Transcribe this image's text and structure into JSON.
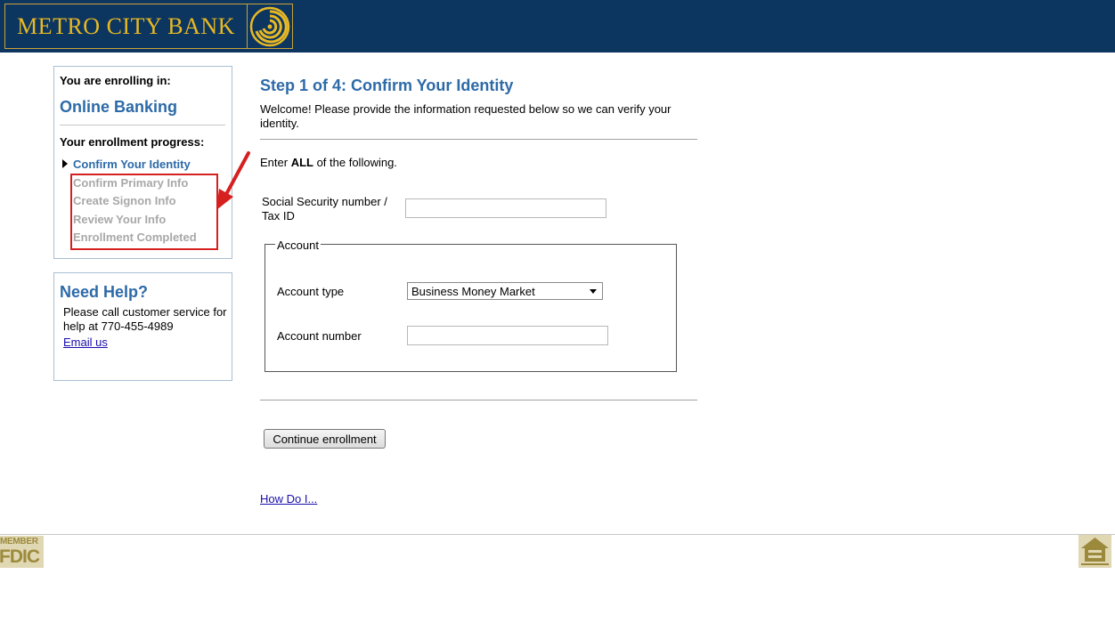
{
  "header": {
    "bank_name": "METRO CITY BANK",
    "logo_icon": "gold-swirl-emblem-icon",
    "colors": {
      "header_bg": "#0c3560",
      "logo_gold": "#e8b923"
    }
  },
  "sidebar": {
    "enroll_label": "You are enrolling in:",
    "product_name": "Online Banking",
    "progress_label": "Your enrollment progress:",
    "steps": [
      {
        "label": "Confirm Your Identity",
        "state": "current"
      },
      {
        "label": "Confirm Primary Info",
        "state": "pending"
      },
      {
        "label": "Create Signon Info",
        "state": "pending"
      },
      {
        "label": "Review Your Info",
        "state": "pending"
      },
      {
        "label": "Enrollment Completed",
        "state": "pending"
      }
    ],
    "help": {
      "title": "Need Help?",
      "text": "Please call customer service for help at  770-455-4989",
      "email_link": "Email us"
    }
  },
  "main": {
    "step_title": "Step 1 of 4: Confirm Your Identity",
    "description": "Welcome! Please provide the information requested below so we can verify your identity.",
    "enter_all": {
      "prefix": "Enter ",
      "bold": "ALL",
      "suffix": " of the following."
    },
    "ssn": {
      "label": "Social Security number / Tax ID",
      "value": ""
    },
    "account": {
      "legend": "Account",
      "type_label": "Account type",
      "type_selected": "Business Money Market",
      "number_label": "Account number",
      "number_value": ""
    },
    "continue_button": "Continue enrollment",
    "howdoi_link": "How Do I..."
  },
  "footer": {
    "fdic": {
      "top": "MEMBER",
      "bottom": "FDIC"
    },
    "equal_housing_icon": "equal-housing-lender-icon"
  },
  "annotation": {
    "color": "#d62020"
  }
}
